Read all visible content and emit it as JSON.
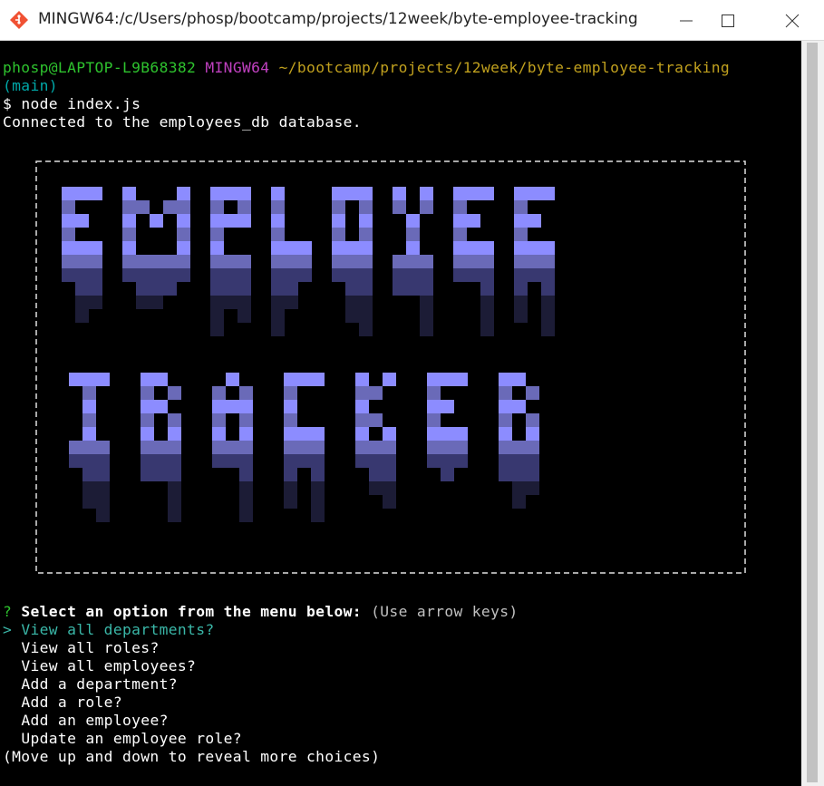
{
  "window": {
    "title": "MINGW64:/c/Users/phosp/bootcamp/projects/12week/byte-employee-tracking",
    "app_icon": "git-bash-icon",
    "controls": [
      "minimize-icon",
      "maximize-icon",
      "close-icon"
    ]
  },
  "prompt": {
    "user_host": "phosp@LAPTOP-L9B68382",
    "shell": "MINGW64",
    "path": "~/bootcamp/projects/12week/byte-employee-tracking",
    "branch": "(main)",
    "symbol": "$",
    "command": "node index.js"
  },
  "output": {
    "connected": "Connected to the employees_db database."
  },
  "banner": {
    "words": [
      "EMPLOYEE",
      "TRACKER"
    ],
    "colors": {
      "bright": "#8c8cff",
      "mid": "#6a6ab8",
      "dim": "#383870",
      "dark": "#1c1c36",
      "border": "#e0e0e0"
    }
  },
  "menu": {
    "question_mark": "?",
    "question": "Select an option from the menu below:",
    "hint": "(Use arrow keys)",
    "pointer": ">",
    "items": [
      "View all departments?",
      "View all roles?",
      "View all employees?",
      "Add a department?",
      "Add a role?",
      "Add an employee?",
      "Update an employee role?"
    ],
    "selected_index": 0,
    "footer": "(Move up and down to reveal more choices)"
  },
  "colors": {
    "prompt_green": "#2ec22e",
    "prompt_purple": "#bf40bf",
    "prompt_yellow": "#c0a01e",
    "selected_teal": "#3ab7a8"
  }
}
